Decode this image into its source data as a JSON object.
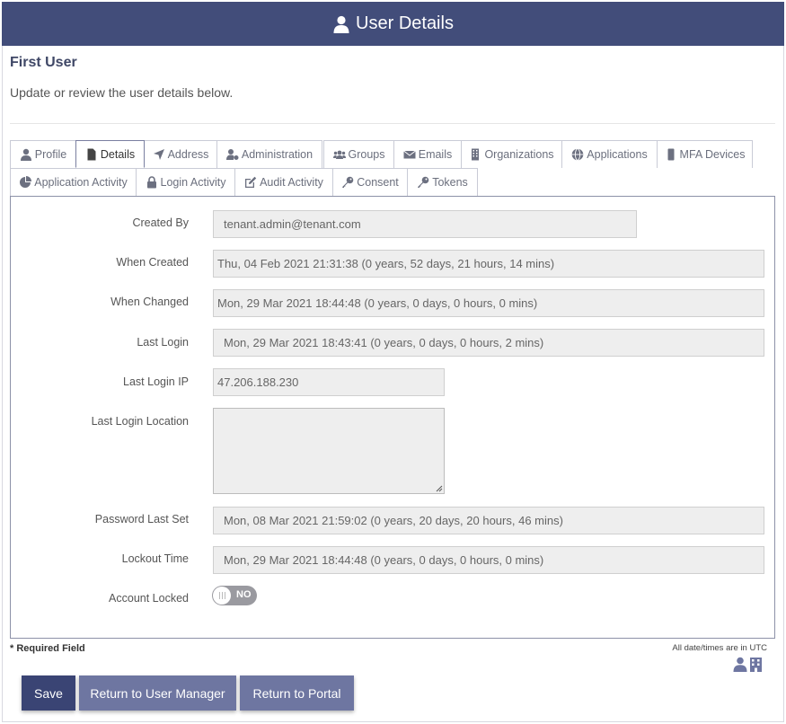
{
  "header": {
    "title": "User Details",
    "icon": "user-icon"
  },
  "user": {
    "name": "First User"
  },
  "subtitle": "Update or review the user details below.",
  "tabs": [
    {
      "label": "Profile",
      "icon": "user-icon"
    },
    {
      "label": "Details",
      "icon": "document-icon",
      "active": true
    },
    {
      "label": "Address",
      "icon": "location-arrow-icon"
    },
    {
      "label": "Administration",
      "icon": "user-cog-icon"
    },
    {
      "label": "Groups",
      "icon": "users-icon"
    },
    {
      "label": "Emails",
      "icon": "envelope-icon"
    },
    {
      "label": "Organizations",
      "icon": "building-icon"
    },
    {
      "label": "Applications",
      "icon": "globe-icon"
    },
    {
      "label": "MFA Devices",
      "icon": "mobile-icon"
    },
    {
      "label": "Application Activity",
      "icon": "pie-chart-icon"
    },
    {
      "label": "Login Activity",
      "icon": "lock-icon"
    },
    {
      "label": "Audit Activity",
      "icon": "edit-icon"
    },
    {
      "label": "Consent",
      "icon": "key-icon"
    },
    {
      "label": "Tokens",
      "icon": "key-icon"
    }
  ],
  "details": {
    "created_by": {
      "label": "Created By",
      "value": "tenant.admin@tenant.com"
    },
    "when_created": {
      "label": "When Created",
      "value": "Thu, 04 Feb 2021 21:31:38 (0 years, 52 days, 21 hours, 14 mins)"
    },
    "when_changed": {
      "label": "When Changed",
      "value": "Mon, 29 Mar 2021 18:44:48 (0 years, 0 days, 0 hours, 0 mins)"
    },
    "last_login": {
      "label": "Last Login",
      "value": "Mon, 29 Mar 2021 18:43:41 (0 years, 0 days, 0 hours, 2 mins)"
    },
    "last_login_ip": {
      "label": "Last Login IP",
      "value": "47.206.188.230"
    },
    "last_login_location": {
      "label": "Last Login Location",
      "value": ""
    },
    "password_last_set": {
      "label": "Password Last Set",
      "value": "Mon, 08 Mar 2021 21:59:02 (0 years, 20 days, 20 hours, 46 mins)"
    },
    "lockout_time": {
      "label": "Lockout Time",
      "value": "Mon, 29 Mar 2021 18:44:48 (0 years, 0 days, 0 hours, 0 mins)"
    },
    "account_locked": {
      "label": "Account Locked",
      "value": "NO"
    }
  },
  "footer": {
    "required_note": "* Required Field",
    "utc_note": "All date/times are in UTC"
  },
  "buttons": {
    "save": "Save",
    "return_user_manager": "Return to User Manager",
    "return_portal": "Return to Portal"
  },
  "colors": {
    "header_bg": "#424d7a",
    "primary_button": "#3a4474",
    "secondary_button": "#6e76a1"
  }
}
